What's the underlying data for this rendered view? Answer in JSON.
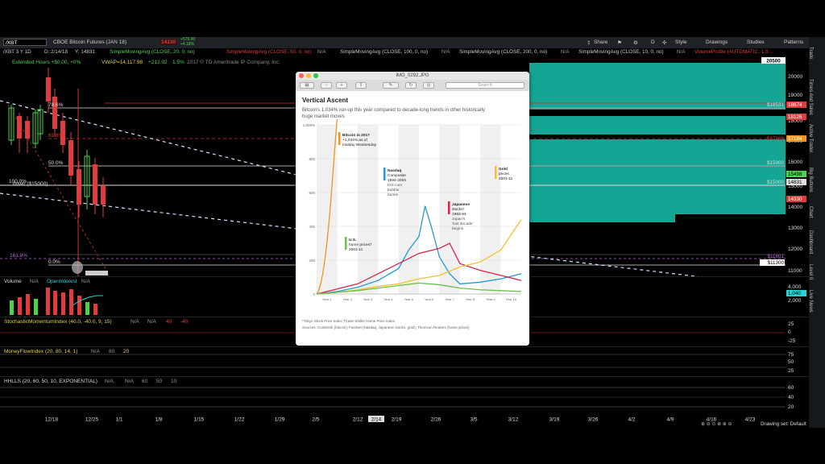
{
  "toolbar": {
    "symbol": "/XBT",
    "contract": "CBOE Bitcoin Futures (JAN 18)",
    "last_price": "14130",
    "change_up": "+575.00",
    "change_pct": "+4.18%",
    "share": "Share",
    "style": "Style",
    "drawings": "Drawings",
    "studies": "Studies",
    "patterns": "Patterns",
    "d_label": "D"
  },
  "studybar": {
    "period": "/XBT 3 Y 1D",
    "date": "D: 2/14/18",
    "y": "Y: 14831",
    "sma1": "SimpleMovingAvg (CLOSE, 20, 0, no)",
    "sma2": "SimpleMovingAvg (CLOSE, 50, 0, no)",
    "sma3": "SimpleMovingAvg (CLOSE, 100, 0, no)",
    "sma4": "SimpleMovingAvg (CLOSE, 200, 0, no)",
    "sma5": "SimpleMovingAvg (CLOSE, 10, 0, no)",
    "vp": "VolumeProfile (AUTOMATIC, 1.5...",
    "na": "N/A"
  },
  "ext": {
    "ext_hours": "Extended Hours +$0.00, +0%",
    "vwap": "VWAP=14,117.98",
    "vwap_chg": "+212.02",
    "vwap_pct": "1.5%",
    "copyright": "2017 © TD Ameritrade IP Company, Inc."
  },
  "fib": {
    "f786": "78.6%",
    "f618": "61.8%",
    "f50": "50.0%",
    "f100": "100.0%",
    "f1618": "161.8%",
    "f0": "0.0%",
    "down": "down ($15000)"
  },
  "price_axis": {
    "ticks": [
      "20000",
      "19000",
      "18000",
      "17000",
      "16000",
      "15000",
      "14000",
      "13000",
      "12000",
      "11000"
    ],
    "box_20500": "20500",
    "box_18674": "18674",
    "box_18126": "18126",
    "box_17184": "17184",
    "box_15498": "15498",
    "box_14831": "14831",
    "box_14330": "14330",
    "line_18531": "$18531",
    "line_17168": "$17168",
    "line_15900": "$15900",
    "line_15000": "$15000",
    "line_11601": "$11601",
    "line_11300": "$11300"
  },
  "volume": {
    "label": "Volume",
    "na": "N/A",
    "oi": "OpenInterest",
    "oi_na": "N/A",
    "ticks": [
      "4,000",
      "2,000"
    ],
    "box": "1,040"
  },
  "stoch": {
    "label": "StochasticMomentumIndex (40.0, -40.0, 9, 15)",
    "na": "N/A",
    "v1": "40",
    "v2": "-40",
    "ticks": [
      "25",
      "0",
      "-25"
    ]
  },
  "mfi": {
    "label": "MoneyFlowIndex (20, 80, 14, 1)",
    "na": "N/A",
    "v1": "80",
    "v2": "20",
    "ticks": [
      "75",
      "50",
      "25"
    ]
  },
  "hhll": {
    "label": "HHLLS (20, 60, 50, 10, EXPONENTIAL)",
    "na": "N/A",
    "v1": "60",
    "v2": "50",
    "v3": "10",
    "ticks": [
      "60",
      "40",
      "20"
    ]
  },
  "xaxis": {
    "labels": [
      "12/18",
      "12/25",
      "1/1",
      "1/8",
      "1/15",
      "1/22",
      "1/29",
      "2/5",
      "2/12",
      "2/14",
      "2/19",
      "2/26",
      "3/5",
      "3/12",
      "3/19",
      "3/26",
      "4/2",
      "4/9",
      "4/16",
      "4/23"
    ],
    "drawing_set": "Drawing set: Default"
  },
  "rail": [
    "Trade",
    "Times And Sales",
    "Active Trader",
    "Big Buttons",
    "Chart",
    "Dashboard",
    "Level II",
    "Live News"
  ],
  "viewer": {
    "filename": "IMG_0292.JPG",
    "search": "Search",
    "title": "Vertical Ascent",
    "subtitle_l1": "Bitcoin's 1,034% run-up this year compared to decade-long trends in other historically",
    "subtitle_l2": "huge market moves",
    "footnote1": "*Tokyo Stock Price Index   †Case-Shiller Home Price Index",
    "footnote2": "Sources: CoinDesk (bitcoin); FactSet (Nasdaq, Japanese stocks, gold); Thomson Reuters (home prices)",
    "colors": {
      "bitcoin": "#f0941f",
      "nasdaq": "#1f9bd1",
      "japan": "#d6254a",
      "gold": "#f2c230",
      "us": "#6cc04a"
    }
  },
  "chart_data": {
    "type": "line",
    "title": "Vertical Ascent",
    "subtitle": "Bitcoin's 1,034% run-up this year compared to decade-long trends in other historically huge market moves",
    "ylim": [
      0,
      1000
    ],
    "yticks": [
      "1,000%",
      "800",
      "600",
      "400",
      "200",
      "0"
    ],
    "categories": [
      "Year 1",
      "Year 2",
      "Year 3",
      "Year 4",
      "Year 5",
      "Year 6",
      "Year 7",
      "Year 8",
      "Year 9",
      "Year 10"
    ],
    "annotations": {
      "bitcoin": [
        "Bitcoin in 2017",
        "+1,034% as of",
        "midday Wednesday"
      ],
      "nasdaq": [
        "Nasdaq",
        "Composite",
        "1994-2004",
        "Dot-com",
        "bubble",
        "bursts"
      ],
      "japan": [
        "Japanese",
        "stocks*",
        "1983-93",
        "Japan's",
        "'lost decade'",
        "begins"
      ],
      "gold": [
        "Gold",
        "prices",
        "2001-11"
      ],
      "us": [
        "U.S.",
        "home prices†",
        "2001-11"
      ]
    },
    "series": [
      {
        "name": "Bitcoin in 2017",
        "x": [
          0.0,
          0.1,
          0.2,
          0.3,
          0.4,
          0.5,
          0.6,
          0.7,
          0.8,
          0.9,
          1.0
        ],
        "values": [
          0,
          20,
          60,
          120,
          200,
          300,
          420,
          560,
          720,
          880,
          1034
        ]
      },
      {
        "name": "Nasdaq Composite 1994-2004",
        "x": [
          0,
          1,
          2,
          3,
          4,
          4.5,
          5,
          5.3,
          5.6,
          6,
          6.5,
          7,
          8,
          9,
          10
        ],
        "values": [
          0,
          15,
          40,
          80,
          150,
          260,
          340,
          520,
          400,
          220,
          120,
          60,
          70,
          90,
          120
        ]
      },
      {
        "name": "Japanese stocks 1983-93",
        "x": [
          0,
          1,
          2,
          3,
          4,
          5,
          6,
          6.5,
          7,
          8,
          9,
          10
        ],
        "values": [
          0,
          30,
          60,
          120,
          180,
          240,
          270,
          300,
          180,
          140,
          110,
          80
        ]
      },
      {
        "name": "Gold prices 2001-11",
        "x": [
          0,
          1,
          2,
          3,
          4,
          5,
          6,
          7,
          8,
          9,
          10
        ],
        "values": [
          0,
          10,
          25,
          45,
          60,
          90,
          110,
          160,
          190,
          260,
          440
        ]
      },
      {
        "name": "U.S. home prices 2001-11",
        "x": [
          0,
          1,
          2,
          3,
          4,
          5,
          6,
          7,
          8,
          9,
          10
        ],
        "values": [
          0,
          10,
          20,
          35,
          50,
          65,
          55,
          35,
          25,
          20,
          15
        ]
      }
    ]
  }
}
